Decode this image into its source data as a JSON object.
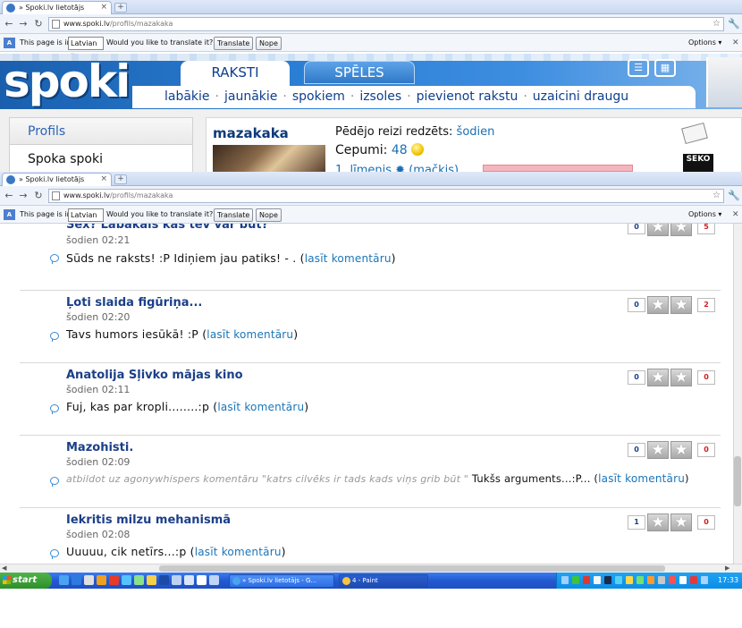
{
  "browser_top": {
    "tab_title": "» Spoki.lv lietotājs",
    "url_domain": "www.spoki.lv",
    "url_path": "/profils/mazakaka",
    "translate": {
      "page_is_in": "This page is in",
      "language": "Latvian",
      "question": "Would you like to translate it?",
      "translate_btn": "Translate",
      "nope_btn": "Nope",
      "options": "Options"
    }
  },
  "browser_bottom": {
    "tab_title": "» Spoki.lv lietotājs",
    "url_domain": "www.spoki.lv",
    "url_path": "/profils/mazakaka",
    "translate": {
      "page_is_in": "This page is in",
      "language": "Latvian",
      "question": "Would you like to translate it?",
      "translate_btn": "Translate",
      "nope_btn": "Nope",
      "options": "Options"
    }
  },
  "site": {
    "logo": "spoki",
    "tabs": [
      "RAKSTI",
      "SPĒLES"
    ],
    "subnav": [
      "labākie",
      "jaunākie",
      "spokiem",
      "izsoles",
      "pievienot rakstu",
      "uzaicini draugu"
    ]
  },
  "profile": {
    "sidebar": [
      "Profils",
      "Spoka spoki"
    ],
    "username": "mazakaka",
    "seen_label": "Pēdējo reizi redzēts:",
    "seen_value": "šodien",
    "cepumi_label": "Cepumi:",
    "cepumi_value": "48",
    "level_text": "1. līmenis",
    "level_suffix": "(mačkis)",
    "seko": "SEKO"
  },
  "posts": [
    {
      "title": "Sex? Labākais kas tev var būt?",
      "time": "šodien 02:21",
      "reply_prefix": "",
      "comment": "Sūds ne raksts! :P Idiņiem jau patiks! - . (",
      "link": "lasīt komentāru",
      "close": ")",
      "plus": "0",
      "minus": "5"
    },
    {
      "title": "Ļoti slaida figūriņa...",
      "time": "šodien 02:20",
      "reply_prefix": "",
      "comment": "Tavs humors iesūkā! :P (",
      "link": "lasīt komentāru",
      "close": ")",
      "plus": "0",
      "minus": "2"
    },
    {
      "title": "Anatolija Sļivko mājas kino",
      "time": "šodien 02:11",
      "reply_prefix": "",
      "comment": "Fuj, kas par kropli........:p (",
      "link": "lasīt komentāru",
      "close": ")",
      "plus": "0",
      "minus": "0"
    },
    {
      "title": "Mazohisti.",
      "time": "šodien 02:09",
      "reply_prefix": "atbildot uz agonywhispers komentāru \"katrs cilvēks ir tads kads viņs grib būt \"",
      "comment": " Tukšs arguments...:P... (",
      "link": "lasīt komentāru",
      "close": ")",
      "plus": "0",
      "minus": "0"
    },
    {
      "title": "Iekritis milzu mehanismā",
      "time": "šodien 02:08",
      "reply_prefix": "",
      "comment": "Uuuuu, cik netīrs...:p (",
      "link": "lasīt komentāru",
      "close": ")",
      "plus": "1",
      "minus": "0"
    }
  ],
  "taskbar": {
    "start": "start",
    "task1": "» Spoki.lv lietotājs - G...",
    "task2": "4 - Paint",
    "clock": "17:33"
  },
  "colors": {
    "link": "#1a75b8",
    "title": "#1b3f88",
    "header_blue": "#2a7fd4",
    "negative": "#d21c1c"
  }
}
